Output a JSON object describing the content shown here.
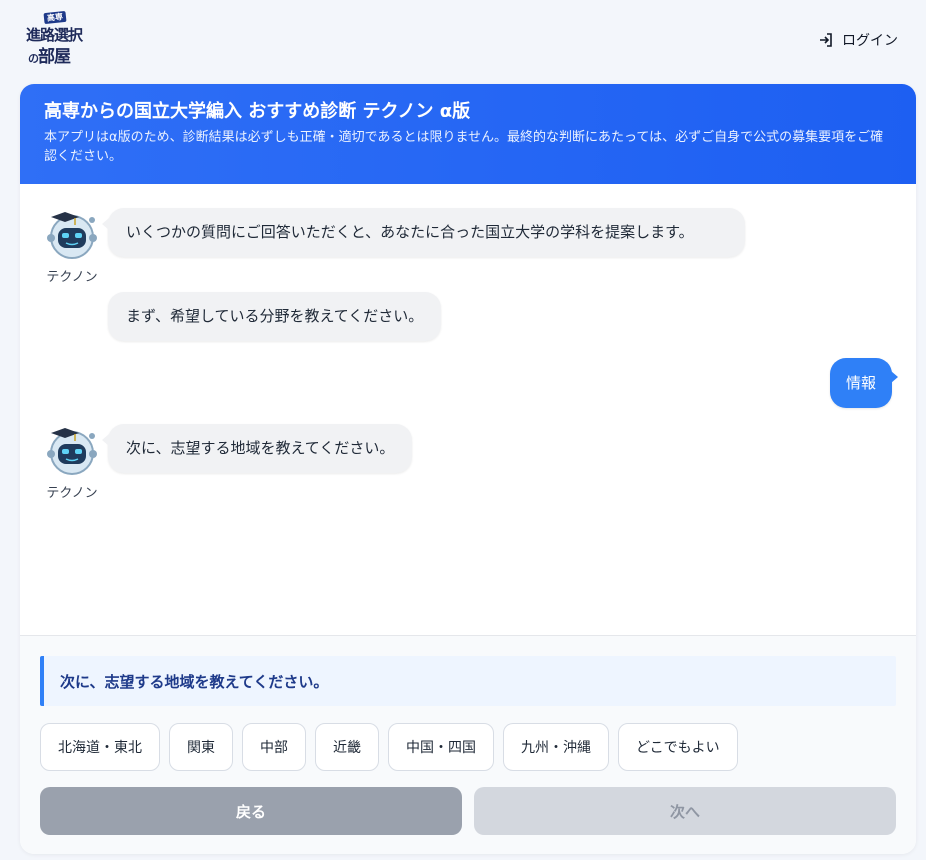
{
  "logo": {
    "badge": "高専",
    "line1": "進路選択",
    "line2_no": "の",
    "line2": "部屋"
  },
  "topbar": {
    "login_label": "ログイン"
  },
  "header": {
    "title": "高専からの国立大学編入 おすすめ診断 テクノン α版",
    "subtitle": "本アプリはα版のため、診断結果は必ずしも正確・適切であるとは限りません。最終的な判断にあたっては、必ずご自身で公式の募集要項をご確認ください。"
  },
  "bot": {
    "name": "テクノン"
  },
  "messages": {
    "bot1_a": "いくつかの質問にご回答いただくと、あなたに合った国立大学の学科を提案します。",
    "bot1_b": "まず、希望している分野を教えてください。",
    "user1": "情報",
    "bot2": "次に、志望する地域を教えてください。"
  },
  "question": {
    "prompt": "次に、志望する地域を教えてください。"
  },
  "options": [
    "北海道・東北",
    "関東",
    "中部",
    "近畿",
    "中国・四国",
    "九州・沖縄",
    "どこでもよい"
  ],
  "nav": {
    "back_label": "戻る",
    "next_label": "次へ"
  },
  "colors": {
    "accent": "#2f80f7",
    "header": "#1d5ff2",
    "back_button": "#9aa1ad",
    "next_button_disabled": "#d3d7de"
  }
}
